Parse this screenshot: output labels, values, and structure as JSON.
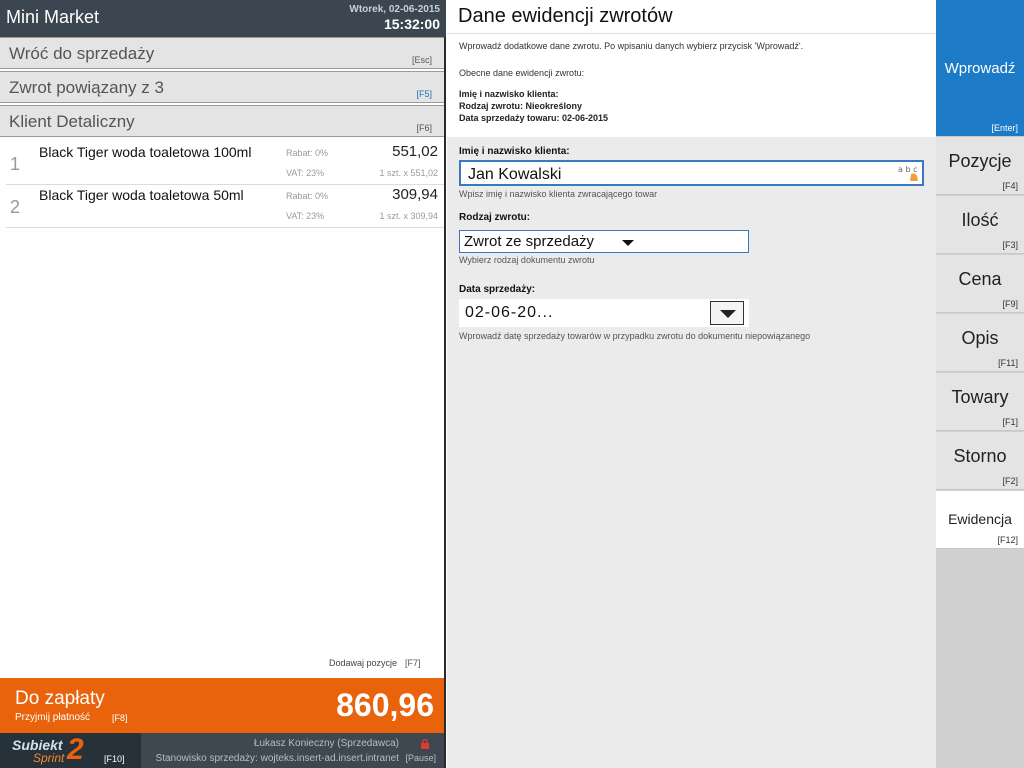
{
  "header": {
    "app_name": "Mini Market",
    "date": "Wtorek, 02-06-2015",
    "time": "15:32:00"
  },
  "nav": [
    {
      "label": "Wróć do sprzedaży",
      "key": "[Esc]"
    },
    {
      "label": "Zwrot powiązany z 3",
      "key": "[F5]"
    },
    {
      "label": "Klient Detaliczny",
      "key": "[F6]"
    }
  ],
  "items": [
    {
      "index": "1",
      "name": "Black Tiger woda toaletowa 100ml",
      "rabat": "Rabat:  0%",
      "vat": "VAT:  23%",
      "price": "551,02",
      "qty": "1 szt. x 551,02"
    },
    {
      "index": "2",
      "name": "Black Tiger woda toaletowa 50ml",
      "rabat": "Rabat:  0%",
      "vat": "VAT:  23%",
      "price": "309,94",
      "qty": "1 szt. x 309,94"
    }
  ],
  "add_position": {
    "label": "Dodawaj pozycje",
    "key": "[F7]"
  },
  "payment": {
    "title": "Do zapłaty",
    "subtitle": "Przyjmij płatność",
    "key": "[F8]",
    "total": "860,96"
  },
  "footer": {
    "logo_text": "Subiekt",
    "logo_sub": "Sprint",
    "logo_num": "2",
    "logo_key": "[F10]",
    "user": "Łukasz Konieczny (Sprzedawca)",
    "station": "Stanowisko sprzedaży: wojteks.insert-ad.insert.intranet",
    "pause": "[Pause]"
  },
  "form": {
    "title": "Dane ewidencji zwrotów",
    "intro": "Wprowadź dodatkowe dane zwrotu. Po wpisaniu danych wybierz przycisk 'Wprowadź'.",
    "current_heading": "Obecne dane ewidencji zwrotu:",
    "current_lines": [
      "Imię i nazwisko klienta:",
      "Rodzaj zwrotu: Nieokreślony",
      "Data sprzedaży towaru: 02-06-2015"
    ],
    "name_label": "Imię i nazwisko klienta:",
    "name_value": "Jan Kowalski",
    "name_hint": "Wpisz imię i nazwisko klienta zwracającego towar",
    "abc": "a b c",
    "type_label": "Rodzaj zwrotu:",
    "type_value": "Zwrot ze sprzedaży",
    "type_hint": "Wybierz rodzaj dokumentu zwrotu",
    "date_label": "Data sprzedaży:",
    "date_value": "02-06-20...",
    "date_hint": "Wprowadź datę sprzedaży towarów w przypadku zwrotu do dokumentu niepowiązanego"
  },
  "side_buttons": [
    {
      "label": "Wprowadź",
      "key": "[Enter]"
    },
    {
      "label": "Pozycje",
      "key": "[F4]"
    },
    {
      "label": "Ilość",
      "key": "[F3]"
    },
    {
      "label": "Cena",
      "key": "[F9]"
    },
    {
      "label": "Opis",
      "key": "[F11]"
    },
    {
      "label": "Towary",
      "key": "[F1]"
    },
    {
      "label": "Storno",
      "key": "[F2]"
    },
    {
      "label": "Ewidencja",
      "key": "[F12]"
    }
  ],
  "colors": {
    "accent_blue": "#1d7ac7",
    "pay_orange": "#e8630b",
    "header_dark": "#3c4650"
  }
}
